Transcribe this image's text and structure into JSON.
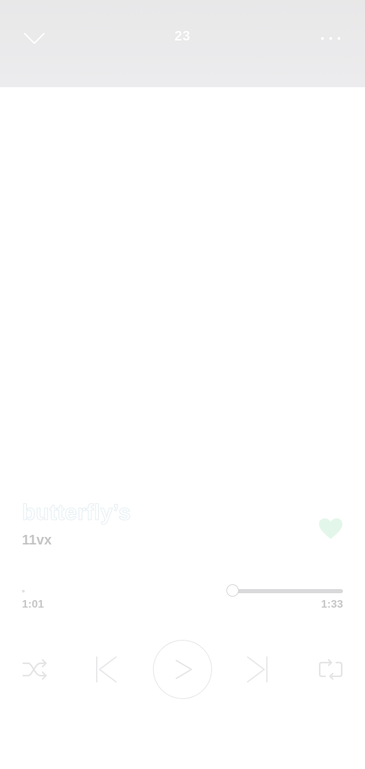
{
  "header": {
    "title": "23",
    "collapse_icon": "chevron-down-icon",
    "more_icon": "more-horizontal-icon"
  },
  "track": {
    "title": "butterfly’s",
    "artist": "11vx",
    "liked": true
  },
  "playback": {
    "elapsed": "1:01",
    "total": "1:33",
    "progress_fraction": 0.656
  },
  "controls": {
    "shuffle_icon": "shuffle-icon",
    "previous_icon": "skip-previous-icon",
    "play_icon": "play-icon",
    "next_icon": "skip-next-icon",
    "repeat_icon": "repeat-icon"
  },
  "colors": {
    "header_background": "#e9e9eb",
    "like_accent": "#e3f6ea",
    "track_progress_remaining": "#d9d9db",
    "muted_text": "#c4c4c6"
  }
}
